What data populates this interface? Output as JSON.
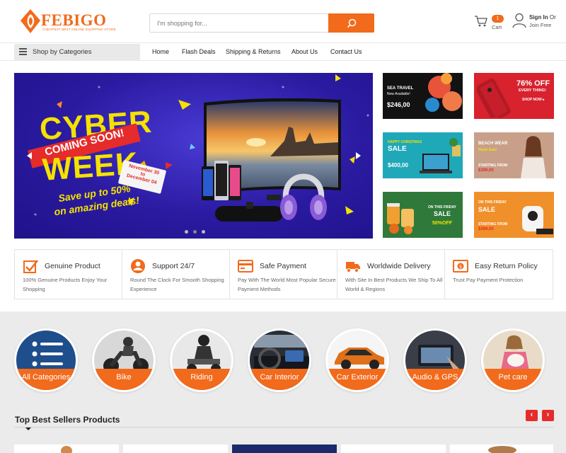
{
  "brand": {
    "name": "FEBIGO",
    "tagline": "CHEAPEST BEST ONLINE SHOPPING STORE",
    "color": "#f26a1b"
  },
  "search": {
    "placeholder": "I'm shopping for..."
  },
  "cart": {
    "count": "1",
    "label": "Cart"
  },
  "account": {
    "sign_in": "Sign In",
    "or": "Or",
    "join": "Join Free"
  },
  "nav": {
    "categories_label": "Shop by Categories",
    "links": [
      "Home",
      "Flash Deals",
      "Shipping & Returns",
      "About Us",
      "Contact Us"
    ]
  },
  "hero": {
    "line1": "CYBER",
    "ribbon": "COMING SOON!",
    "line2": "WEEK",
    "date1": "November 30",
    "date2": "to",
    "date3": "December 04",
    "save1": "Save up to 50%",
    "save2": "on amazing deals!"
  },
  "tiles": {
    "sea": {
      "title": "SEA TRAVEL",
      "sub": "Now Available!",
      "price": "$246,00"
    },
    "off": {
      "big": "76% OFF",
      "sub": "EVERY THING!",
      "cta": "SHOP NOW ▸"
    },
    "xmas": {
      "title": "HAPPY CHRISTMAS",
      "sale": "SALE",
      "price": "$400,00"
    },
    "beach": {
      "title": "BEACH WEAR",
      "sub": "Flash Sale!",
      "start": "STARTING FROM",
      "price": "$399,00"
    },
    "friday1": {
      "title": "ON THIS FRIDAY",
      "sale": "SALE",
      "off": "50%OFF"
    },
    "friday2": {
      "title": "ON THIS FRIDAY",
      "sale": "SALE",
      "start": "STARTING FROM",
      "price": "$399,00"
    }
  },
  "features": [
    {
      "title": "Genuine Product",
      "desc": "100% Genuine Products Enjoy Your Shopping",
      "icon": "checkbox-icon"
    },
    {
      "title": "Support 24/7",
      "desc": "Round The Clock For Smooth Shopping Experience",
      "icon": "support-person-icon"
    },
    {
      "title": "Safe Payment",
      "desc": "Pay With The World Most Popular Secure Payment Methods",
      "icon": "credit-card-icon"
    },
    {
      "title": "Worldwide Delivery",
      "desc": "With Site In Best Products We Ship To All World & Regions",
      "icon": "delivery-truck-icon"
    },
    {
      "title": "Easy Return Policy",
      "desc": "Trust Pay Payment Protection",
      "icon": "money-return-icon"
    }
  ],
  "categories": [
    "All Categories",
    "Bike",
    "Riding",
    "Car Interior",
    "Car Exterior",
    "Audio & GPS",
    "Pet care"
  ],
  "best_sellers": {
    "title": "Top Best Sellers Products",
    "prev": "‹",
    "next": "›"
  }
}
